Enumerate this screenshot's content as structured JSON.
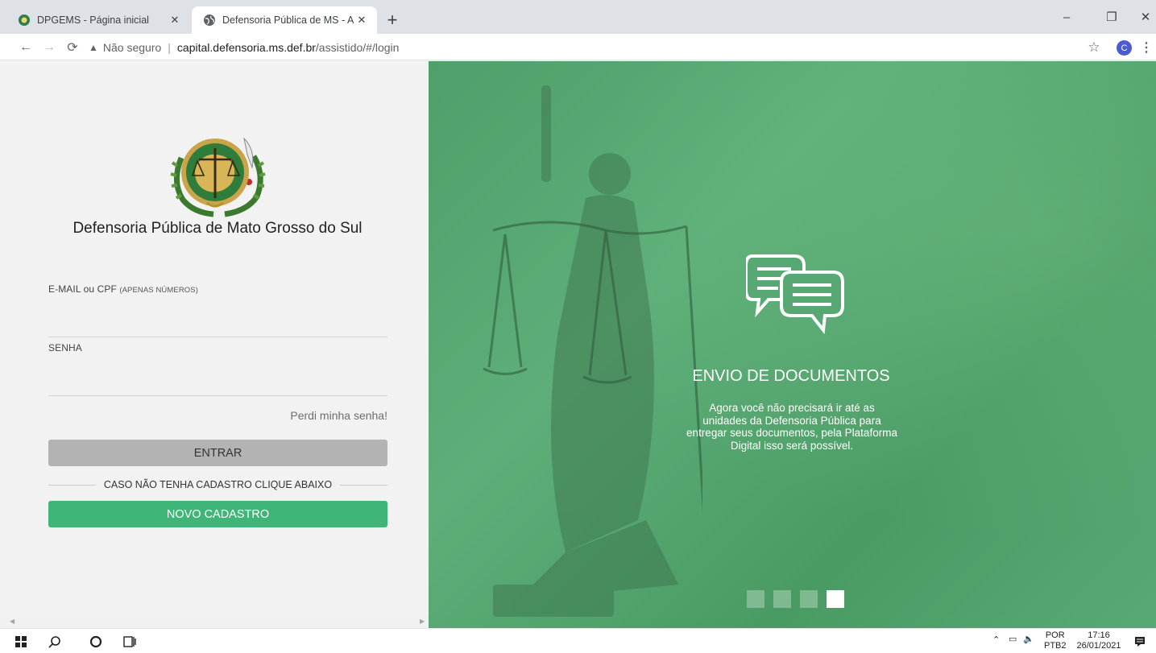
{
  "browser": {
    "tabs": [
      {
        "label": "DPGEMS - Página inicial",
        "active": false
      },
      {
        "label": "Defensoria Pública de MS - Ambi",
        "active": true
      }
    ],
    "new_tab": "+",
    "address": {
      "security_label": "Não seguro",
      "separator": "|",
      "host": "capital.defensoria.ms.def.br",
      "path": "/assistido/#/login"
    },
    "profile_initial": "C"
  },
  "login": {
    "org_name": "Defensoria Pública de Mato Grosso do Sul",
    "email_label": "E-MAIL ou CPF",
    "email_hint": "(APENAS NÚMEROS)",
    "email_value": "",
    "password_label": "SENHA",
    "password_value": "",
    "forgot_link": "Perdi minha senha!",
    "enter_button": "ENTRAR",
    "divider_text": "CASO NÃO TENHA CADASTRO CLIQUE ABAIXO",
    "register_button": "NOVO CADASTRO"
  },
  "carousel": {
    "title": "ENVIO DE DOCUMENTOS",
    "text": "Agora você não precisará ir até as unidades da Defensoria Pública para entregar seus documentos, pela Plataforma Digital isso será possível.",
    "slide_count": 4,
    "active_slide": 4,
    "accent_color": "#40b578"
  },
  "taskbar": {
    "language_top": "POR",
    "language_bottom": "PTB2",
    "time": "17:16",
    "date": "26/01/2021"
  }
}
